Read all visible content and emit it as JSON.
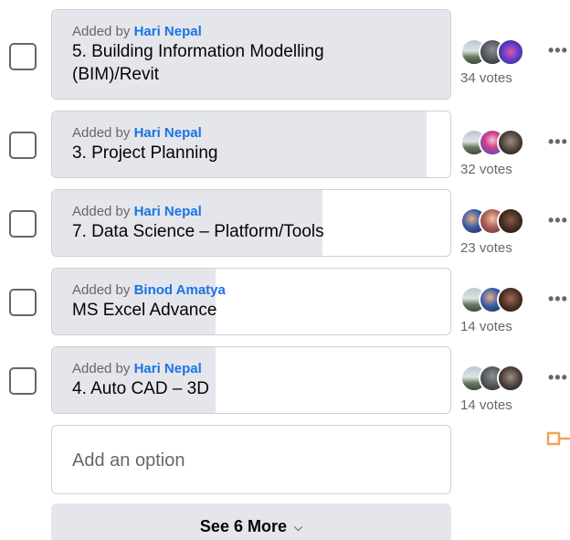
{
  "options": [
    {
      "added_by_prefix": "Added by",
      "author": "Hari Nepal",
      "label_line1": "5. Building Information Modelling",
      "label_line2": "(BIM)/Revit",
      "votes": "34 votes",
      "fill_fraction": 1.0,
      "voter_icons": [
        "avatar-lake",
        "avatar-grey",
        "avatar-colorful"
      ]
    },
    {
      "added_by_prefix": "Added by",
      "author": "Hari Nepal",
      "label_line1": "3. Project Planning",
      "label_line2": "",
      "votes": "32 votes",
      "fill_fraction": 0.94,
      "voter_icons": [
        "avatar-lake",
        "avatar-colorful",
        "avatar-dark"
      ]
    },
    {
      "added_by_prefix": "Added by",
      "author": "Hari Nepal",
      "label_line1": "7. Data Science – Platform/Tools",
      "label_line2": "",
      "votes": "23 votes",
      "fill_fraction": 0.68,
      "voter_icons": [
        "avatar-group",
        "avatar-person",
        "avatar-dark"
      ]
    },
    {
      "added_by_prefix": "Added by",
      "author": "Binod Amatya",
      "label_line1": "MS Excel Advance",
      "label_line2": "",
      "votes": "14 votes",
      "fill_fraction": 0.41,
      "voter_icons": [
        "avatar-lake",
        "avatar-group",
        "avatar-dark"
      ]
    },
    {
      "added_by_prefix": "Added by",
      "author": "Hari Nepal",
      "label_line1": "4. Auto CAD – 3D",
      "label_line2": "",
      "votes": "14 votes",
      "fill_fraction": 0.41,
      "voter_icons": [
        "avatar-lake",
        "avatar-grey",
        "avatar-dark"
      ]
    }
  ],
  "more_icon": "ellipsis-icon",
  "add_option_placeholder": "Add an option",
  "see_more_label": "See 6 More",
  "colors": {
    "link": "#1b74e4",
    "fill": "#e4e6eb",
    "border": "#ced0d4",
    "muted": "#65676b",
    "accent_orange": "#f0a25a"
  }
}
